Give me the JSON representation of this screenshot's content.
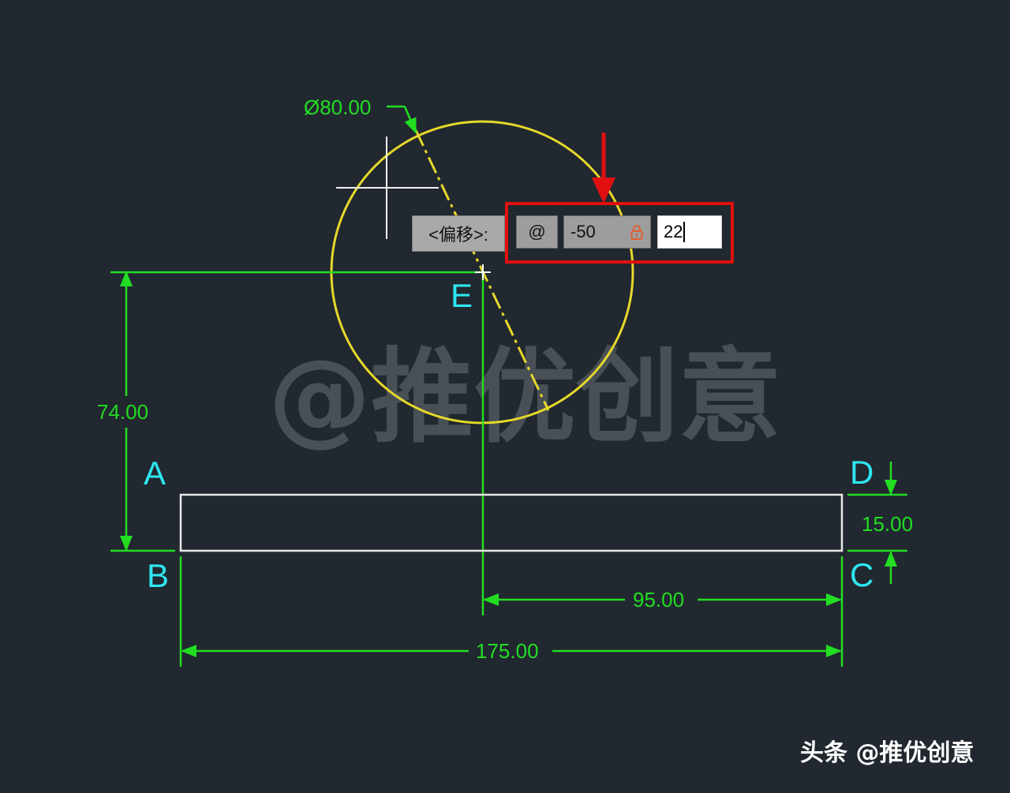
{
  "drawing": {
    "points": {
      "a": "A",
      "b": "B",
      "c": "C",
      "d": "D",
      "e": "E"
    },
    "dimensions": {
      "diameter": "Ø80.00",
      "height": "74.00",
      "thickness": "15.00",
      "offset_width": "95.00",
      "total_width": "175.00"
    },
    "colors": {
      "dimension": "#22dd22",
      "point_label": "#2ee6f0",
      "circle": "#e6d82a",
      "outline": "#e8e8e8",
      "highlight": "#e01010"
    }
  },
  "dynamic_input": {
    "prompt_label": "<偏移>:",
    "relative_symbol": "@",
    "x_value": "-50",
    "y_value": "22",
    "lock_icon": "lock-icon"
  },
  "watermark": "@推优创意",
  "footer": "头条 @推优创意"
}
